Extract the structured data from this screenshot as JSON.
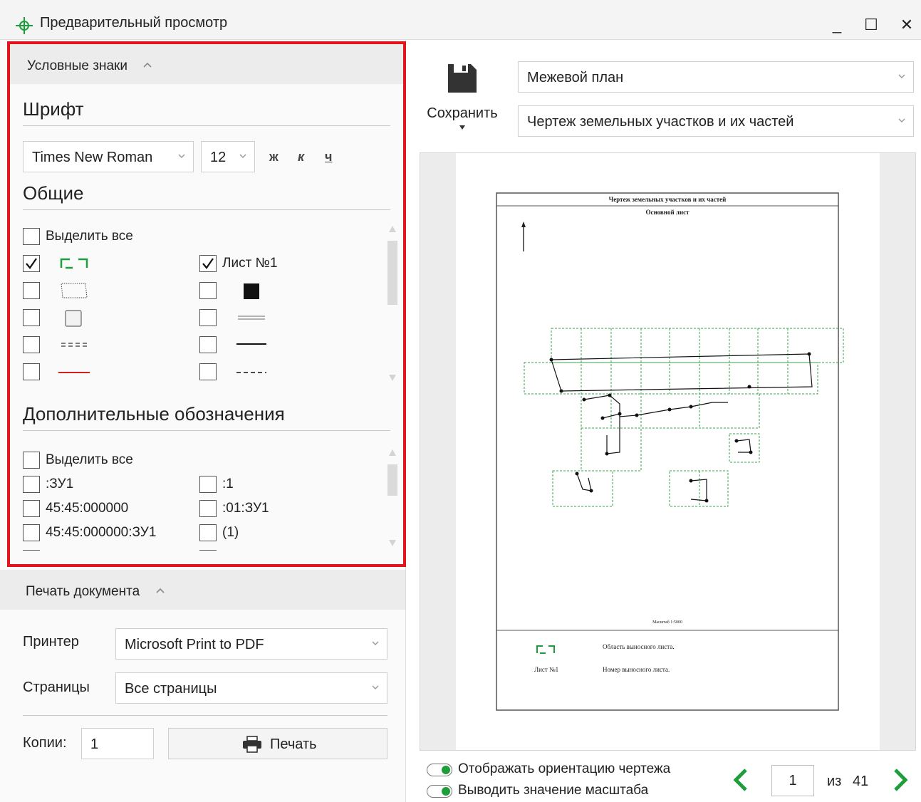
{
  "window": {
    "title": "Предварительный просмотр",
    "minimize": "_",
    "maximize": "☐",
    "close": "✕"
  },
  "legend": {
    "header": "Условные знаки",
    "font_section": "Шрифт",
    "font_family": "Times New Roman",
    "font_size": "12",
    "bold": "ж",
    "italic": "к",
    "underline": "ч",
    "general_section": "Общие",
    "general_select_all": "Выделить все",
    "general_items_left": [
      {
        "checked": true,
        "icon": "green-dashed-bracket-icon"
      },
      {
        "checked": false,
        "icon": "dotted-trapezoid-icon"
      },
      {
        "checked": false,
        "icon": "grey-square-icon"
      },
      {
        "checked": false,
        "icon": "short-dashes-icon"
      },
      {
        "checked": false,
        "icon": "red-line-icon"
      }
    ],
    "general_items_right": [
      {
        "checked": true,
        "label": "Лист №1"
      },
      {
        "checked": false,
        "icon": "black-square-icon"
      },
      {
        "checked": false,
        "icon": "double-line-icon"
      },
      {
        "checked": false,
        "icon": "solid-line-icon"
      },
      {
        "checked": false,
        "icon": "dashed-line-icon"
      }
    ],
    "extra_section": "Дополнительные обозначения",
    "extra_select_all": "Выделить все",
    "extra_items_left": [
      ":ЗУ1",
      "45:45:000000",
      "45:45:000000:ЗУ1"
    ],
    "extra_items_right": [
      ":1",
      ":01:ЗУ1",
      "(1)"
    ]
  },
  "print": {
    "header": "Печать документа",
    "printer_label": "Принтер",
    "printer_value": "Microsoft Print to PDF",
    "pages_label": "Страницы",
    "pages_value": "Все страницы",
    "copies_label": "Копии:",
    "copies_value": "1",
    "print_button": "Печать"
  },
  "preview": {
    "save_label": "Сохранить",
    "doc_type": "Межевой план",
    "doc_section": "Чертеж земельных участков и их частей",
    "sheet_title": "Чертеж земельных участков и их частей",
    "sheet_subtitle": "Основной лист",
    "scale_text": "Масштаб 1:5000",
    "legend_row1_text": "Область выносного листа.",
    "legend_row2_label": "Лист №1",
    "legend_row2_text": "Номер выносного листа."
  },
  "footer": {
    "toggle_orientation": "Отображать ориентацию чертежа",
    "toggle_scale": "Выводить значение масштаба",
    "page_current": "1",
    "page_of": "из",
    "page_total": "41"
  },
  "colors": {
    "accent_green": "#1e9e3a",
    "highlight_red": "#e3141b"
  }
}
